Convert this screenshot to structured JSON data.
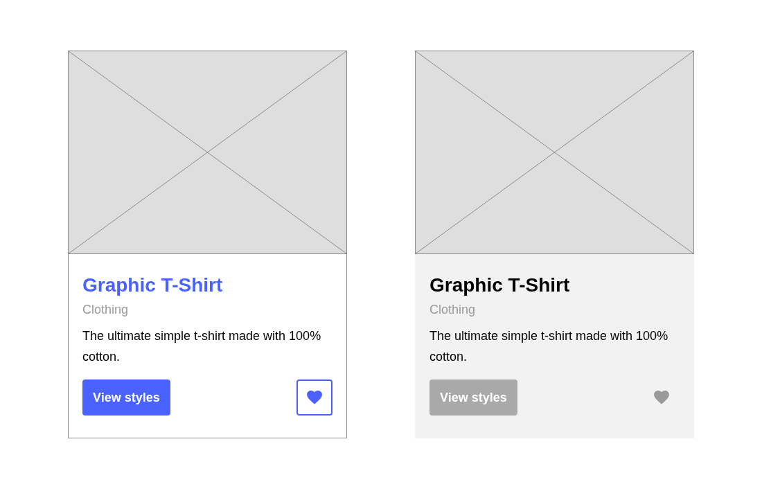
{
  "cards": [
    {
      "title": "Graphic T-Shirt",
      "category": "Clothing",
      "description": "The ultimate simple t-shirt made with 100% cotton.",
      "button": "View styles",
      "disabled": false
    },
    {
      "title": "Graphic T-Shirt",
      "category": "Clothing",
      "description": "The ultimate simple t-shirt made with 100% cotton.",
      "button": "View styles",
      "disabled": true
    }
  ]
}
